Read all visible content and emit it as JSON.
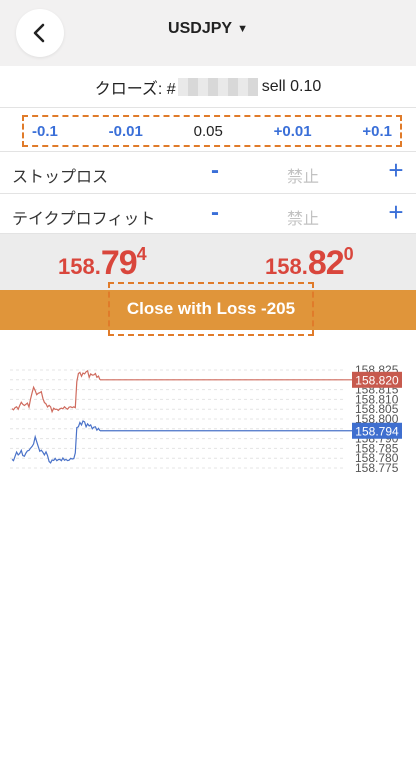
{
  "header": {
    "title": "USDJPY",
    "caret": "▼",
    "back_icon": "chevron-left-icon"
  },
  "close_order": {
    "prefix": "クローズ: #",
    "suffix": "sell 0.10"
  },
  "quantity": {
    "dec_large": "-0.1",
    "dec_small": "-0.01",
    "value": "0.05",
    "inc_small": "+0.01",
    "inc_large": "+0.1"
  },
  "stop_loss": {
    "label": "ストップロス",
    "minus": "-",
    "value": "禁止",
    "plus": "+"
  },
  "take_profit": {
    "label": "テイクプロフィット",
    "minus": "-",
    "value": "禁止",
    "plus": "+"
  },
  "prices": {
    "bid": {
      "big": "158.",
      "pip": "79",
      "frac": "4"
    },
    "ask": {
      "big": "158.",
      "pip": "82",
      "frac": "0"
    },
    "color": "#d9463c"
  },
  "close_button": {
    "label": "Close with Loss -205",
    "bg": "#e0953a"
  },
  "chart_data": {
    "type": "line",
    "axis_ticks": [
      "158.825",
      "158.820",
      "158.815",
      "158.810",
      "158.805",
      "158.800",
      "158.795",
      "158.790",
      "158.785",
      "158.780",
      "158.775"
    ],
    "series": [
      {
        "color": "#cf6b5e",
        "tag_color": "#c75a4e",
        "current": "158.820",
        "current_value": 158.82,
        "values": [
          158.8053,
          158.8047,
          158.8058,
          158.8062,
          158.805,
          158.8069,
          158.8085,
          158.8075,
          158.8069,
          158.8075,
          158.8081,
          158.8061,
          158.8101,
          158.8134,
          158.8162,
          158.8145,
          158.8124,
          158.8131,
          158.8134,
          158.814,
          158.8105,
          158.8084,
          158.8077,
          158.8061,
          158.807,
          158.8062,
          158.8037,
          158.8055,
          158.8049,
          158.805,
          158.8044,
          158.8052,
          158.8055,
          158.8052,
          158.8062,
          158.8055,
          158.805,
          158.806,
          158.8062,
          158.8058,
          158.8062,
          158.8058,
          158.819,
          158.8232,
          158.8238,
          158.8218,
          158.8234,
          158.823,
          158.8241,
          158.8246,
          158.8212,
          158.823,
          158.8224,
          158.8225,
          158.8232,
          158.8213,
          158.8219,
          158.82
        ]
      },
      {
        "color": "#4a72c8",
        "tag_color": "#3f6fcf",
        "current": "158.794",
        "current_value": 158.794,
        "values": [
          158.7794,
          158.7788,
          158.781,
          158.7831,
          158.7817,
          158.7824,
          158.784,
          158.7814,
          158.781,
          158.7826,
          158.7837,
          158.784,
          158.7851,
          158.786,
          158.7873,
          158.7909,
          158.7884,
          158.786,
          158.7835,
          158.7841,
          158.783,
          158.7817,
          158.7832,
          158.7814,
          158.7783,
          158.7776,
          158.7791,
          158.7789,
          158.7799,
          158.7787,
          158.7793,
          158.7794,
          158.7787,
          158.7801,
          158.779,
          158.7794,
          158.7788,
          158.779,
          158.7799,
          158.7796,
          158.7798,
          158.7827,
          158.7956,
          158.796,
          158.7982,
          158.797,
          158.799,
          158.7985,
          158.796,
          158.7975,
          158.7965,
          158.797,
          158.795,
          158.7958,
          158.796,
          158.7943,
          158.7952,
          158.794
        ]
      }
    ]
  }
}
